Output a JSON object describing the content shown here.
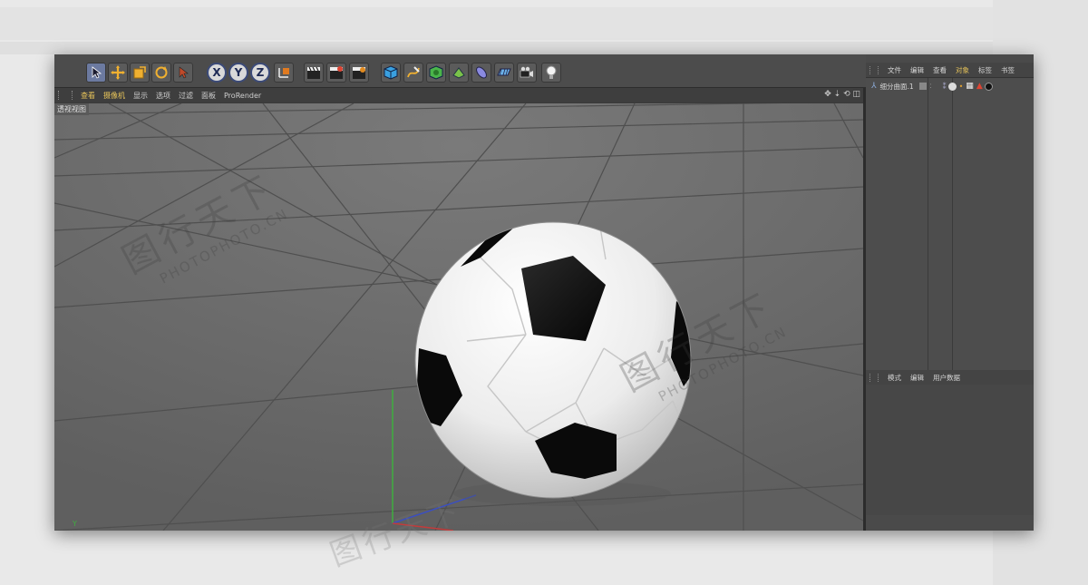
{
  "toolbar": {
    "axis_buttons": [
      "X",
      "Y",
      "Z"
    ]
  },
  "viewport_menu": {
    "items": [
      "查看",
      "摄像机",
      "显示",
      "选项",
      "过滤",
      "面板",
      "ProRender"
    ],
    "active": "摄像机",
    "view_label": "透视视图"
  },
  "object_manager": {
    "menu": [
      "文件",
      "编辑",
      "查看",
      "对象",
      "标签",
      "书签"
    ],
    "active": "对象",
    "objects": [
      {
        "name": "细分曲面.1",
        "icon": "subdivision-icon"
      }
    ]
  },
  "attribute_manager": {
    "menu": [
      "模式",
      "编辑",
      "用户数据"
    ]
  },
  "viewport_axis": {
    "y_label": "Y"
  },
  "watermark": {
    "brand": "图行天下",
    "domain": "PHOTOPHOTO.CN"
  },
  "colors": {
    "ball_white": "#f2f2f2",
    "ball_black": "#111111",
    "floor": "#6e6e6e",
    "grid": "#4f4f4f",
    "accent": "#e6c35a",
    "x_axis": "#c23b3b",
    "y_axis": "#3fae3f",
    "z_axis": "#3b4fc2"
  }
}
